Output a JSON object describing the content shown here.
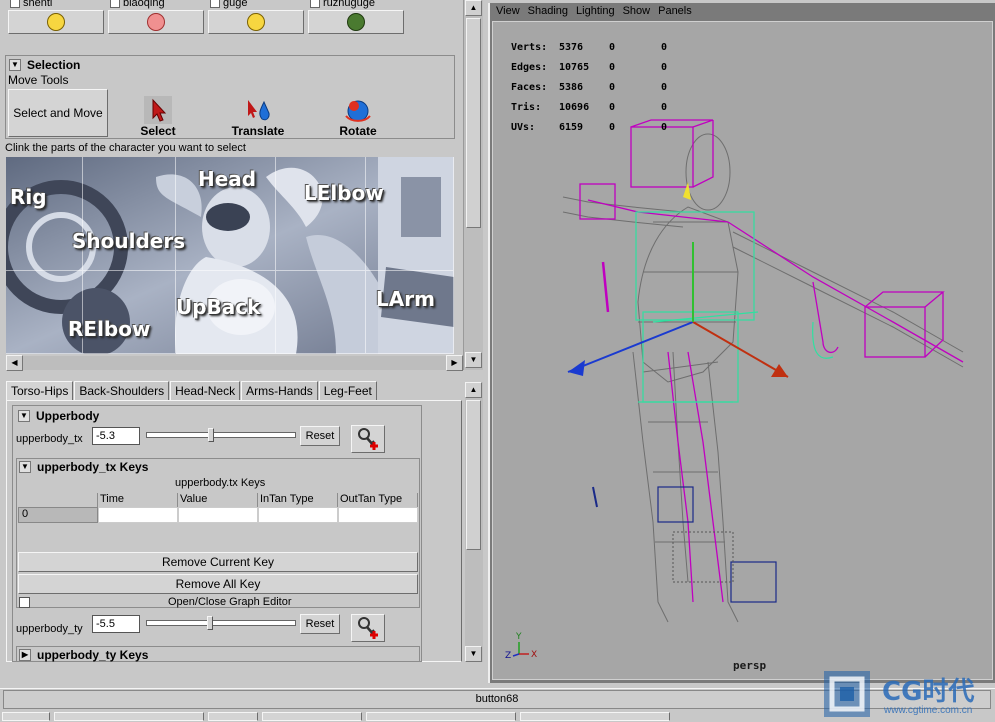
{
  "emoji_row": [
    {
      "label": "shenti",
      "icon": "smiley-face-icon",
      "color": "#f7d640"
    },
    {
      "label": "biaoqing",
      "icon": "angry-face-icon",
      "color": "#f09090"
    },
    {
      "label": "guge",
      "icon": "grin-face-icon",
      "color": "#f7d640"
    },
    {
      "label": "ruznuguge",
      "icon": "soldier-face-icon",
      "color": "#4a7a30"
    }
  ],
  "selection": {
    "title": "Selection",
    "subtitle": "Move Tools",
    "select_and_move": "Select and Move",
    "tools": [
      {
        "label": "Select",
        "icon": "select-arrow-icon"
      },
      {
        "label": "Translate",
        "icon": "translate-tool-icon"
      },
      {
        "label": "Rotate",
        "icon": "rotate-tool-icon"
      }
    ]
  },
  "picker": {
    "instruction": "Clink the parts of the character you want to select",
    "labels": [
      "Rig",
      "Head",
      "LElbow",
      "Shoulders",
      "RElbow",
      "UpBack",
      "LArm"
    ]
  },
  "tabs": [
    "Torso-Hips",
    "Back-Shoulders",
    "Head-Neck",
    "Arms-Hands",
    "Leg-Feet"
  ],
  "active_tab": "Torso-Hips",
  "upperbody": {
    "title": "Upperbody",
    "tx_label": "upperbody_tx",
    "tx_value": "-5.3",
    "tx_slider": 0.43,
    "reset": "Reset",
    "keys_title": "upperbody_tx Keys",
    "keys_caption": "upperbody.tx Keys",
    "columns": [
      "Time",
      "Value",
      "InTan Type",
      "OutTan Type"
    ],
    "rows": [
      [
        "0",
        "",
        "",
        "",
        ""
      ]
    ],
    "remove_current": "Remove Current Key",
    "remove_all": "Remove All Key",
    "graph_editor": "Open/Close Graph Editor",
    "ty_label": "upperbody_ty",
    "ty_value": "-5.5",
    "ty_slider": 0.42,
    "ty_keys_title": "upperbody_ty Keys"
  },
  "viewport": {
    "menu": [
      "View",
      "Shading",
      "Lighting",
      "Show",
      "Panels"
    ],
    "stats": [
      {
        "name": "Verts:",
        "v1": "5376",
        "v2": "0",
        "v3": "0"
      },
      {
        "name": "Edges:",
        "v1": "10765",
        "v2": "0",
        "v3": "0"
      },
      {
        "name": "Faces:",
        "v1": "5386",
        "v2": "0",
        "v3": "0"
      },
      {
        "name": "Tris:",
        "v1": "10696",
        "v2": "0",
        "v3": "0"
      },
      {
        "name": "UVs:",
        "v1": "6159",
        "v2": "0",
        "v3": "0"
      }
    ],
    "camera": "persp",
    "axis_labels": {
      "y": "Y",
      "z": "Z",
      "x": "X"
    }
  },
  "status_button": "button68",
  "watermark": {
    "brand": "CG时代",
    "url": "www.cgtime.com.cn"
  },
  "colors": {
    "panel": "#c8c8c8",
    "viewport_bg": "#a6a6a6",
    "rig_magenta": "#c000c0",
    "rig_green": "#30e0a0",
    "mesh": "#6e6e6e"
  }
}
